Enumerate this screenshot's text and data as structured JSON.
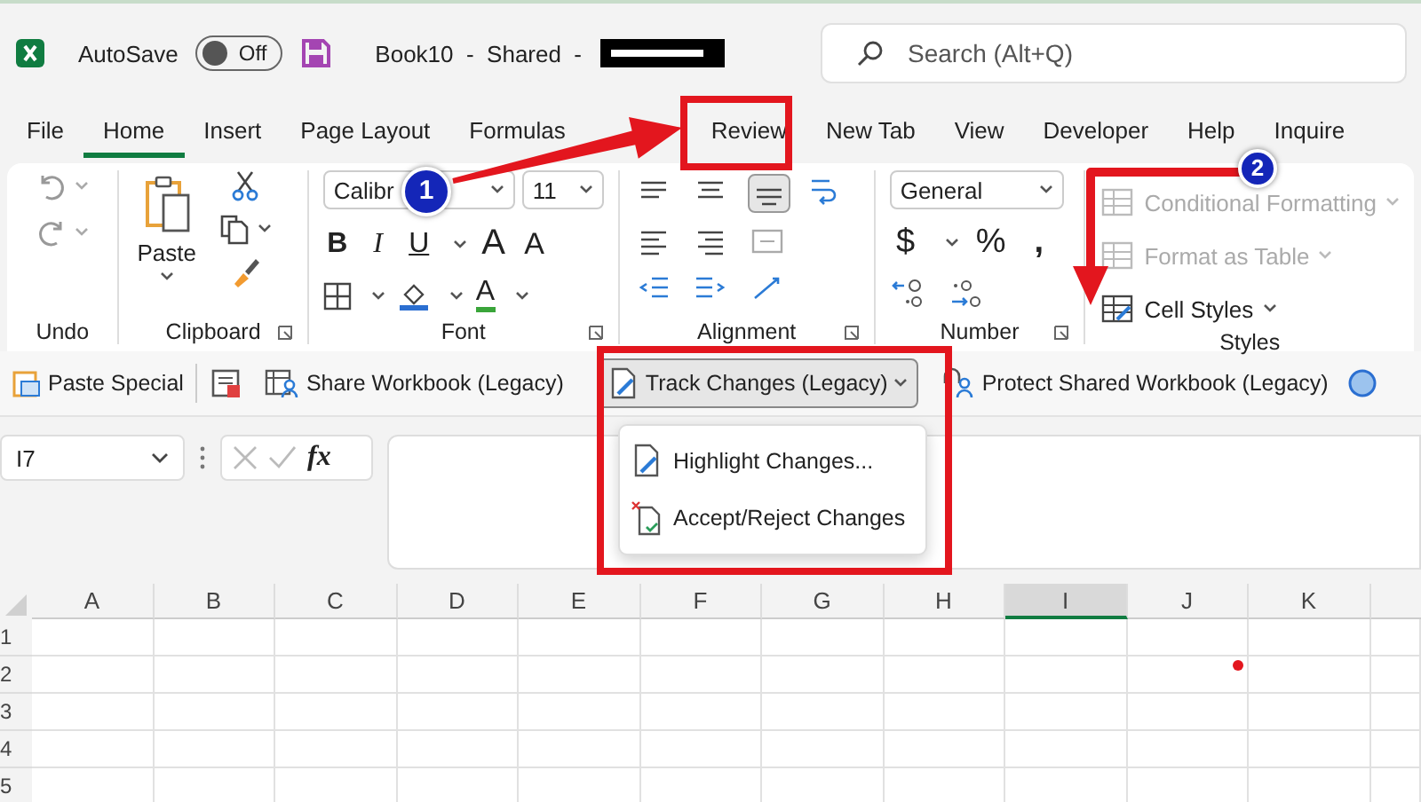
{
  "title_bar": {
    "autosave_label": "AutoSave",
    "autosave": {
      "on": false,
      "label": "Off"
    },
    "document_title": "Book10  -  Shared  -",
    "search": {
      "placeholder": "Search (Alt+Q)"
    }
  },
  "tabs": [
    {
      "label": "File",
      "selected": false
    },
    {
      "label": "Home",
      "selected": true
    },
    {
      "label": "Insert",
      "selected": false
    },
    {
      "label": "Page Layout",
      "selected": false
    },
    {
      "label": "Formulas",
      "selected": false
    },
    {
      "label": "Review",
      "selected": false
    },
    {
      "label": "New Tab",
      "selected": false
    },
    {
      "label": "View",
      "selected": false
    },
    {
      "label": "Developer",
      "selected": false
    },
    {
      "label": "Help",
      "selected": false
    },
    {
      "label": "Inquire",
      "selected": false
    }
  ],
  "ribbon": {
    "undo": {
      "label": "Undo"
    },
    "clipboard": {
      "label": "Clipboard",
      "paste": "Paste"
    },
    "font": {
      "label": "Font",
      "name": "Calibr",
      "size": "11",
      "bold": "B",
      "italic": "I",
      "underline": "U",
      "grow": "A",
      "shrink": "A",
      "font_color_letter": "A"
    },
    "alignment": {
      "label": "Alignment"
    },
    "number": {
      "label": "Number",
      "format": "General",
      "currency": "$",
      "percent": "%",
      "comma": ","
    },
    "styles": {
      "label": "Styles",
      "items": [
        {
          "label": "Conditional Formatting",
          "disabled": true
        },
        {
          "label": "Format as Table",
          "disabled": true
        },
        {
          "label": "Cell Styles",
          "disabled": false
        }
      ]
    }
  },
  "legacy_toolbar": [
    {
      "kind": "paste",
      "label": "Paste Special",
      "selected": false
    },
    {
      "kind": "document",
      "selected": false
    },
    {
      "kind": "share",
      "label": "Share Workbook (Legacy)",
      "selected": false
    },
    {
      "kind": "track",
      "label": "Track Changes (Legacy)",
      "selected": true
    },
    {
      "kind": "protect",
      "label": "Protect Shared Workbook (Legacy)",
      "selected": false
    },
    {
      "kind": "circle",
      "selected": false
    }
  ],
  "formula_bar": {
    "name_box": "I7",
    "function_label": "fx"
  },
  "dropdown_menu": [
    {
      "kind": "highlight",
      "label": "Highlight Changes..."
    },
    {
      "kind": "accept",
      "label": "Accept/Reject Changes"
    }
  ],
  "grid": {
    "columns": [
      {
        "label": "A",
        "selected": false
      },
      {
        "label": "B",
        "selected": false
      },
      {
        "label": "C",
        "selected": false
      },
      {
        "label": "D",
        "selected": false
      },
      {
        "label": "E",
        "selected": false
      },
      {
        "label": "F",
        "selected": false
      },
      {
        "label": "G",
        "selected": false
      },
      {
        "label": "H",
        "selected": false
      },
      {
        "label": "I",
        "selected": true
      },
      {
        "label": "J",
        "selected": false
      },
      {
        "label": "K",
        "selected": false
      }
    ],
    "rows": [
      "1",
      "2",
      "3",
      "4",
      "5"
    ]
  },
  "annotations": {
    "markers": [
      {
        "label": "1"
      },
      {
        "label": "2"
      }
    ]
  }
}
